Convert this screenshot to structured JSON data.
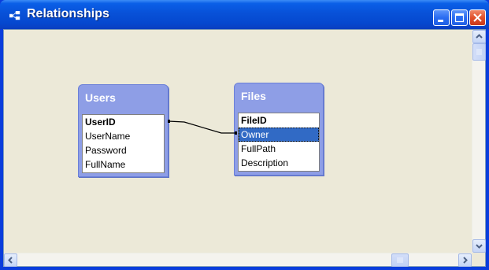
{
  "window": {
    "title": "Relationships",
    "icons": {
      "app": "relationships-icon",
      "minimize": "minimize-icon",
      "maximize": "maximize-icon",
      "close": "close-icon"
    },
    "colors": {
      "titlebar": "#0851d8",
      "close_button": "#e2512b",
      "canvas": "#ece9d8",
      "table_header": "#8e9ee6",
      "selection": "#316ac5"
    }
  },
  "tables": [
    {
      "name": "Users",
      "fields": [
        "UserID",
        "UserName",
        "Password",
        "FullName"
      ],
      "primary_key": "UserID"
    },
    {
      "name": "Files",
      "fields": [
        "FileID",
        "Owner",
        "FullPath",
        "Description"
      ],
      "primary_key": "FileID",
      "selected_field": "Owner"
    }
  ],
  "relationship": {
    "from": "Users.UserID",
    "to": "Files.Owner"
  },
  "scrollbars": {
    "vertical_icons": [
      "scroll-up-icon",
      "scroll-down-icon"
    ],
    "horizontal_icons": [
      "scroll-left-icon",
      "scroll-right-icon"
    ]
  }
}
